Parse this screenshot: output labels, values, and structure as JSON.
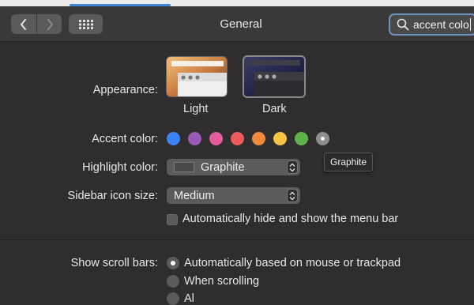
{
  "window": {
    "title": "General"
  },
  "search": {
    "value": "accent colo"
  },
  "appearance": {
    "label": "Appearance:",
    "options": [
      {
        "name": "Light"
      },
      {
        "name": "Dark",
        "selected": true
      }
    ]
  },
  "accent": {
    "label": "Accent color:",
    "colors": [
      "#3b82f6",
      "#9b59b6",
      "#e35d9c",
      "#ec5a5a",
      "#ef8a3c",
      "#f6c344",
      "#5fb34a",
      "#8e8e8e"
    ],
    "selected_index": 7,
    "tooltip": "Graphite"
  },
  "highlight": {
    "label": "Highlight color:",
    "value": "Graphite",
    "swatch_color": "#4a4849"
  },
  "sidebar_icon": {
    "label": "Sidebar icon size:",
    "value": "Medium"
  },
  "menubar": {
    "label": "Automatically hide and show the menu bar",
    "checked": false
  },
  "scroll_bars": {
    "label": "Show scroll bars:",
    "options": [
      {
        "label": "Automatically based on mouse or trackpad",
        "selected": true
      },
      {
        "label": "When scrolling",
        "selected": false
      },
      {
        "label": "Al",
        "selected": false
      }
    ]
  }
}
